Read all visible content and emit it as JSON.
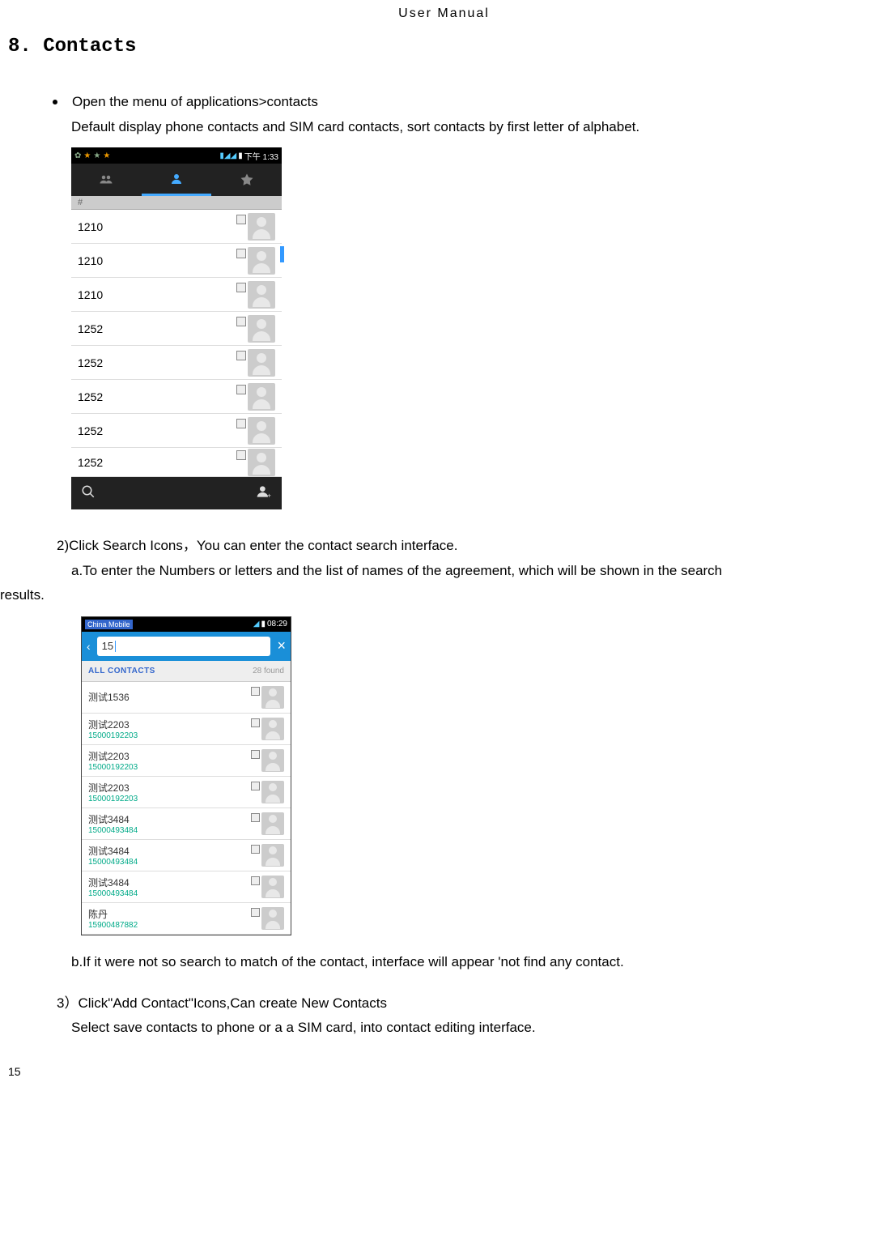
{
  "header": "User    Manual",
  "section_title": "8. Contacts",
  "bullet_text": "Open the menu of applications>contacts",
  "desc1": "Default display phone contacts and SIM card contacts, sort contacts by first letter of alphabet.",
  "step2_prefix": "2)Click Search Icons，You c",
  "step2_suffix": "an enter the contact search interface.",
  "step2a": "a.To enter the Numbers or letters and the list of names of the agreement, which will be shown in the search",
  "step2a_cont": "results.",
  "step2b": "b.If it were not so search to match of the contact, interface will appear 'not find any contact.",
  "step3": "3）Click\"Add    Contact\"Icons,Can create New Contacts",
  "step3_desc": "Select save contacts to phone or a a SIM card, into contact editing interface.",
  "page_number": "15",
  "screenshot1": {
    "time": "下午 1:33",
    "section_char": "#",
    "contacts": [
      "1210",
      "1210",
      "1210",
      "1252",
      "1252",
      "1252",
      "1252",
      "1252"
    ]
  },
  "screenshot2": {
    "carrier": "China Mobile",
    "time": "08:29",
    "search_value": "15",
    "filter": "ALL CONTACTS",
    "found": "28 found",
    "results": [
      {
        "name": "测试1536",
        "number": ""
      },
      {
        "name": "测试2203",
        "number": "15000192203"
      },
      {
        "name": "测试2203",
        "number": "15000192203"
      },
      {
        "name": "测试2203",
        "number": "15000192203"
      },
      {
        "name": "测试3484",
        "number": "15000493484"
      },
      {
        "name": "测试3484",
        "number": "15000493484"
      },
      {
        "name": "测试3484",
        "number": "15000493484"
      },
      {
        "name": "陈丹",
        "number": "15900487882"
      }
    ]
  }
}
